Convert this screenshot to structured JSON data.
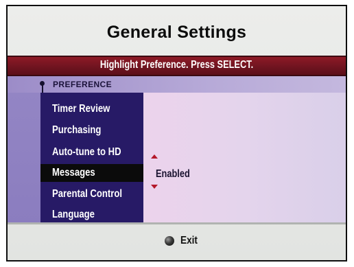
{
  "header": {
    "title": "General Settings"
  },
  "hint": {
    "text": "Highlight Preference. Press SELECT."
  },
  "preference_bar": {
    "label": "PREFERENCE"
  },
  "menu": {
    "items": [
      {
        "label": "Timer Review"
      },
      {
        "label": "Purchasing"
      },
      {
        "label": "Auto-tune to HD"
      },
      {
        "label": "Messages",
        "selected": true
      },
      {
        "label": "Parental Control"
      },
      {
        "label": "Language"
      }
    ]
  },
  "value": {
    "text": "Enabled"
  },
  "footer": {
    "exit_label": "Exit",
    "exit_icon": "dot-button-icon"
  },
  "colors": {
    "hint_bar": "#701420",
    "menu_bg": "#271a66",
    "selected_bg": "#0b0b0b",
    "arrow": "#b4182a"
  }
}
